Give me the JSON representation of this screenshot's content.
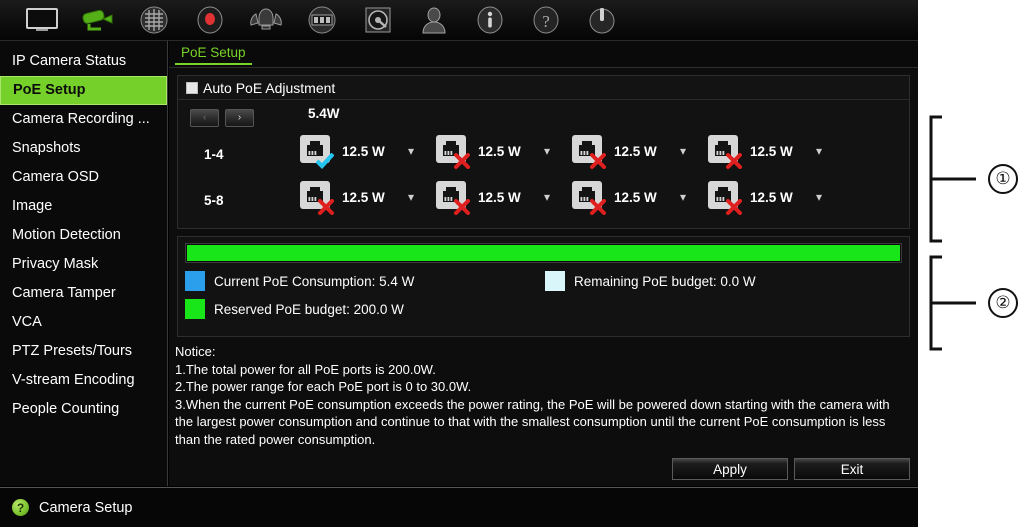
{
  "toolbar": {
    "items": [
      {
        "name": "live-view-icon",
        "label": "Live View"
      },
      {
        "name": "camera-setup-icon",
        "label": "Camera Setup"
      },
      {
        "name": "network-settings-icon",
        "label": "Network"
      },
      {
        "name": "recording-icon",
        "label": "Recording"
      },
      {
        "name": "alarm-icon",
        "label": "Alarm"
      },
      {
        "name": "playback-icon",
        "label": "Playback"
      },
      {
        "name": "hdd-icon",
        "label": "HDD"
      },
      {
        "name": "user-icon",
        "label": "User"
      },
      {
        "name": "info-icon",
        "label": "Information"
      },
      {
        "name": "help-icon",
        "label": "Help"
      },
      {
        "name": "power-icon",
        "label": "Shutdown"
      }
    ]
  },
  "sidebar": {
    "items": [
      {
        "label": "IP Camera Status",
        "active": false
      },
      {
        "label": "PoE Setup",
        "active": true
      },
      {
        "label": "Camera Recording ...",
        "active": false
      },
      {
        "label": "Snapshots",
        "active": false
      },
      {
        "label": "Camera OSD",
        "active": false
      },
      {
        "label": "Image",
        "active": false
      },
      {
        "label": "Motion Detection",
        "active": false
      },
      {
        "label": "Privacy Mask",
        "active": false
      },
      {
        "label": "Camera Tamper",
        "active": false
      },
      {
        "label": "VCA",
        "active": false
      },
      {
        "label": "PTZ Presets/Tours",
        "active": false
      },
      {
        "label": "V-stream Encoding",
        "active": false
      },
      {
        "label": "People Counting",
        "active": false
      }
    ]
  },
  "tab": {
    "label": "PoE Setup"
  },
  "poe": {
    "auto_adjust_label": "Auto PoE Adjustment",
    "auto_adjust_checked": true,
    "prev_arrow": "‹",
    "next_arrow": "›",
    "total_consumption_label": "5.4W",
    "rows": [
      {
        "range": "1-4",
        "ports": [
          {
            "power": "12.5 W",
            "status": "connected"
          },
          {
            "power": "12.5 W",
            "status": "disconnected"
          },
          {
            "power": "12.5 W",
            "status": "disconnected"
          },
          {
            "power": "12.5 W",
            "status": "disconnected"
          }
        ]
      },
      {
        "range": "5-8",
        "ports": [
          {
            "power": "12.5 W",
            "status": "disconnected"
          },
          {
            "power": "12.5 W",
            "status": "disconnected"
          },
          {
            "power": "12.5 W",
            "status": "disconnected"
          },
          {
            "power": "12.5 W",
            "status": "disconnected"
          }
        ]
      }
    ]
  },
  "budget": {
    "bar_fill_percent": 100,
    "bar_color": "#18e618",
    "legend": [
      {
        "label": "Current PoE Consumption: 5.4 W",
        "color": "#2b9fec"
      },
      {
        "label": "Remaining PoE budget: 0.0 W",
        "color": "#d9f7fb"
      },
      {
        "label": "Reserved PoE budget: 200.0 W",
        "color": "#18e618"
      }
    ]
  },
  "notice": {
    "title": "Notice:",
    "lines": [
      "1.The total power for all PoE ports is 200.0W.",
      "2.The power range for each PoE port is 0 to 30.0W.",
      "3.When the current PoE consumption exceeds the power rating, the PoE will be powered down starting with the camera with the largest power consumption and continue to that with the smallest consumption until the current PoE consumption is less than the rated power consumption."
    ]
  },
  "buttons": {
    "apply": "Apply",
    "exit": "Exit"
  },
  "statusbar": {
    "label": "Camera Setup",
    "icon": "?"
  },
  "annotations": [
    {
      "number": "①"
    },
    {
      "number": "②"
    }
  ]
}
